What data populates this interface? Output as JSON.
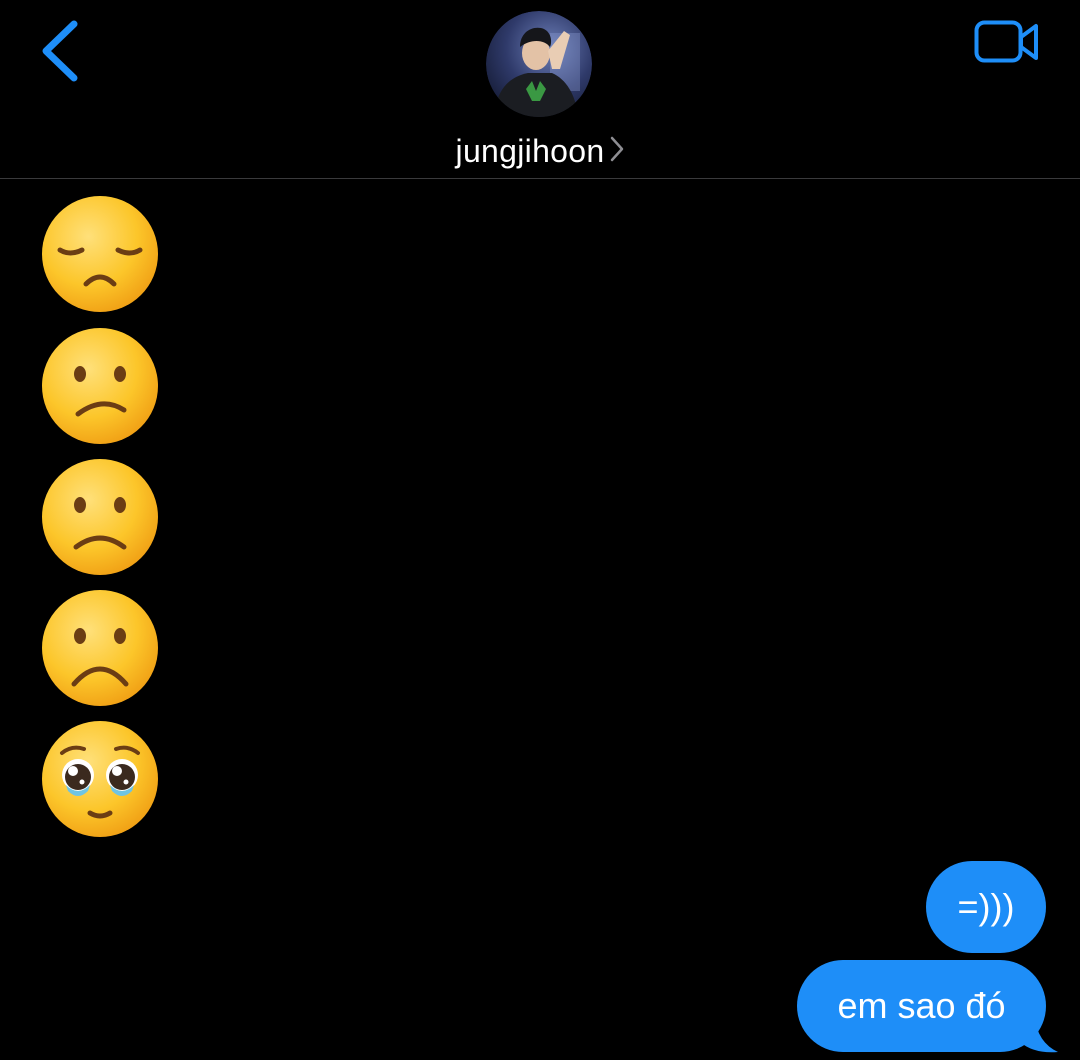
{
  "header": {
    "contact_name": "jungjihoon",
    "back_icon": "chevron-left-icon",
    "video_icon": "video-camera-icon",
    "name_chevron_icon": "chevron-right-icon",
    "accent_color": "#1e8ef8"
  },
  "messages": {
    "received": [
      {
        "type": "emoji",
        "icon": "disappointed-face-emoji"
      },
      {
        "type": "emoji",
        "icon": "confused-face-emoji"
      },
      {
        "type": "emoji",
        "icon": "slightly-frowning-face-emoji"
      },
      {
        "type": "emoji",
        "icon": "frowning-face-emoji"
      },
      {
        "type": "emoji",
        "icon": "pleading-face-emoji"
      }
    ],
    "sent": [
      {
        "text": "=)))"
      },
      {
        "text": "em sao đó"
      }
    ],
    "sent_bubble_color": "#1e8ef8"
  }
}
